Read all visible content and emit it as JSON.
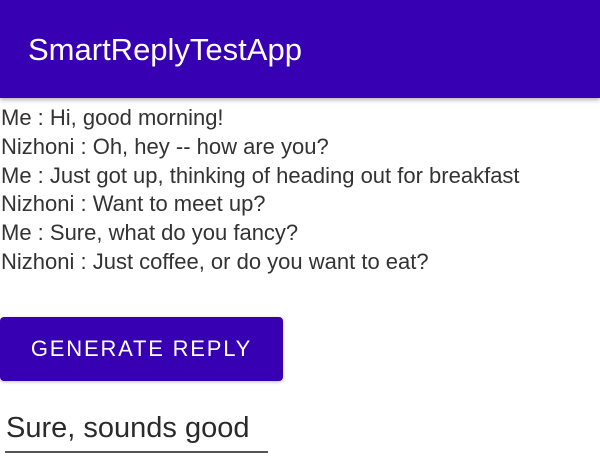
{
  "app_bar": {
    "title": "SmartReplyTestApp",
    "color": "#3700B3"
  },
  "conversation": [
    "Me : Hi, good morning!",
    "Nizhoni : Oh, hey -- how are you?",
    "Me : Just got up, thinking of heading out for breakfast",
    "Nizhoni : Want to meet up?",
    "Me : Sure, what do you fancy?",
    "Nizhoni : Just coffee, or do you want to eat?"
  ],
  "generate_button": {
    "label": "GENERATE REPLY"
  },
  "reply_field": {
    "value": "Sure, sounds good"
  }
}
